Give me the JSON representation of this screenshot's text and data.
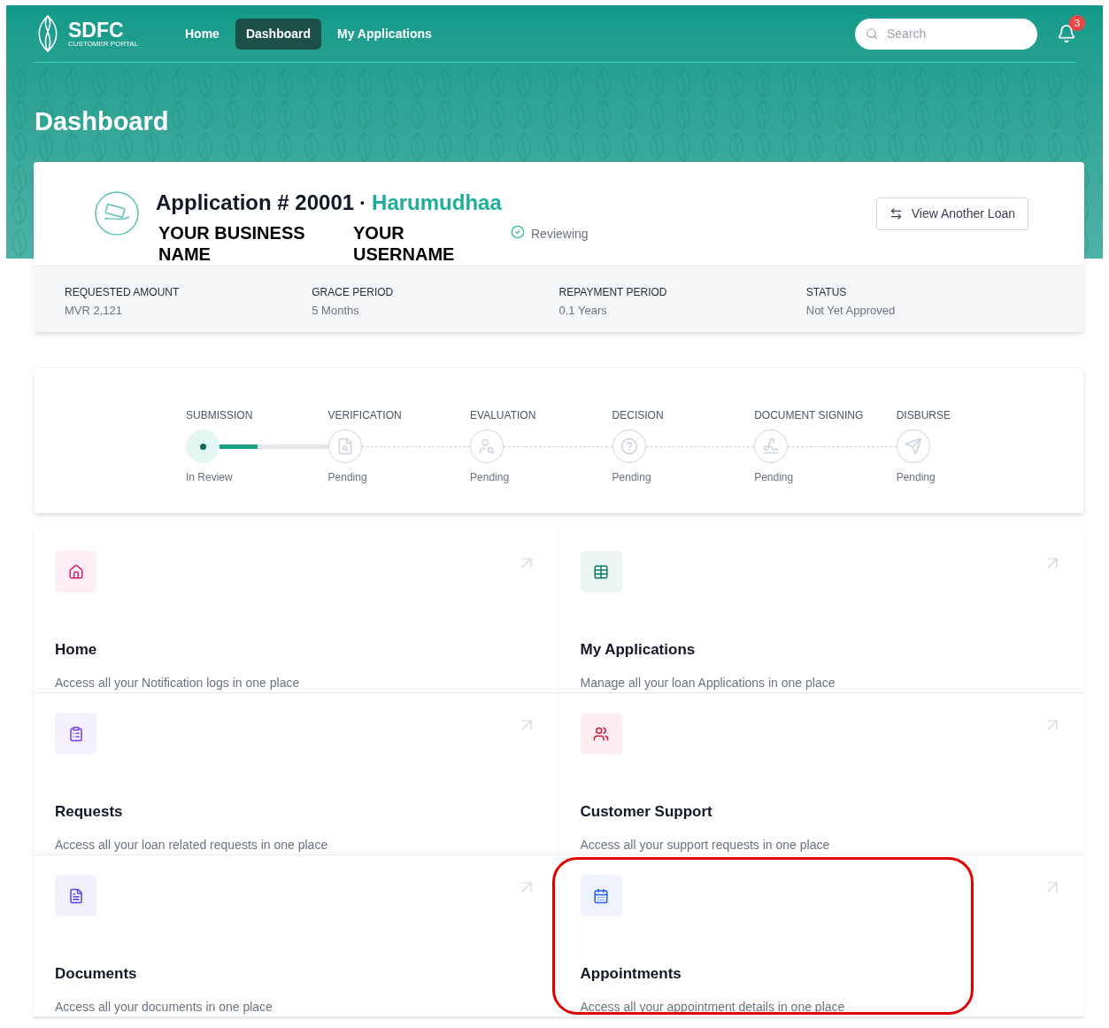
{
  "brand": {
    "name": "SDFC",
    "tagline": "CUSTOMER PORTAL"
  },
  "nav": [
    {
      "label": "Home",
      "selected": false
    },
    {
      "label": "Dashboard",
      "selected": true
    },
    {
      "label": "My Applications",
      "selected": false
    }
  ],
  "search": {
    "placeholder": "Search"
  },
  "notifications": {
    "count": "3"
  },
  "page_title": "Dashboard",
  "application": {
    "title": "Application # 20001",
    "separator": "·",
    "name": "Harumudhaa",
    "business": "YOUR BUSINESS NAME",
    "username": "YOUR USERNAME",
    "status": "Reviewing",
    "button": "View Another Loan",
    "fields": [
      {
        "label": "REQUESTED AMOUNT",
        "value": "MVR 2,121"
      },
      {
        "label": "GRACE PERIOD",
        "value": "5 Months"
      },
      {
        "label": "REPAYMENT PERIOD",
        "value": "0.1 Years"
      },
      {
        "label": "STATUS",
        "value": "Not Yet Approved"
      }
    ]
  },
  "steps": [
    {
      "label": "SUBMISSION",
      "status": "In Review",
      "active": true,
      "level": 0.35
    },
    {
      "label": "VERIFICATION",
      "status": "Pending",
      "active": false
    },
    {
      "label": "EVALUATION",
      "status": "Pending",
      "active": false
    },
    {
      "label": "DECISION",
      "status": "Pending",
      "active": false
    },
    {
      "label": "DOCUMENT SIGNING",
      "status": "Pending",
      "active": false
    },
    {
      "label": "DISBURSE",
      "status": "Pending",
      "active": false
    }
  ],
  "tiles": [
    {
      "title": "Home",
      "description": "Access all your Notification logs in one place",
      "color": "#d6246e",
      "highlighted": false
    },
    {
      "title": "My Applications",
      "description": "Manage all your loan Applications in one place",
      "color": "#117a65",
      "highlighted": false
    },
    {
      "title": "Requests",
      "description": "Access all your loan related requests in one place",
      "color": "#7c3aed",
      "highlighted": false
    },
    {
      "title": "Customer Support",
      "description": "Access all your support requests in one place",
      "color": "#d11a3a",
      "highlighted": false
    },
    {
      "title": "Documents",
      "description": "Access all your documents in one place",
      "color": "#4f46e5",
      "highlighted": false
    },
    {
      "title": "Appointments",
      "description": "Access all your appointment details in one place",
      "color": "#2563eb",
      "highlighted": true
    }
  ]
}
